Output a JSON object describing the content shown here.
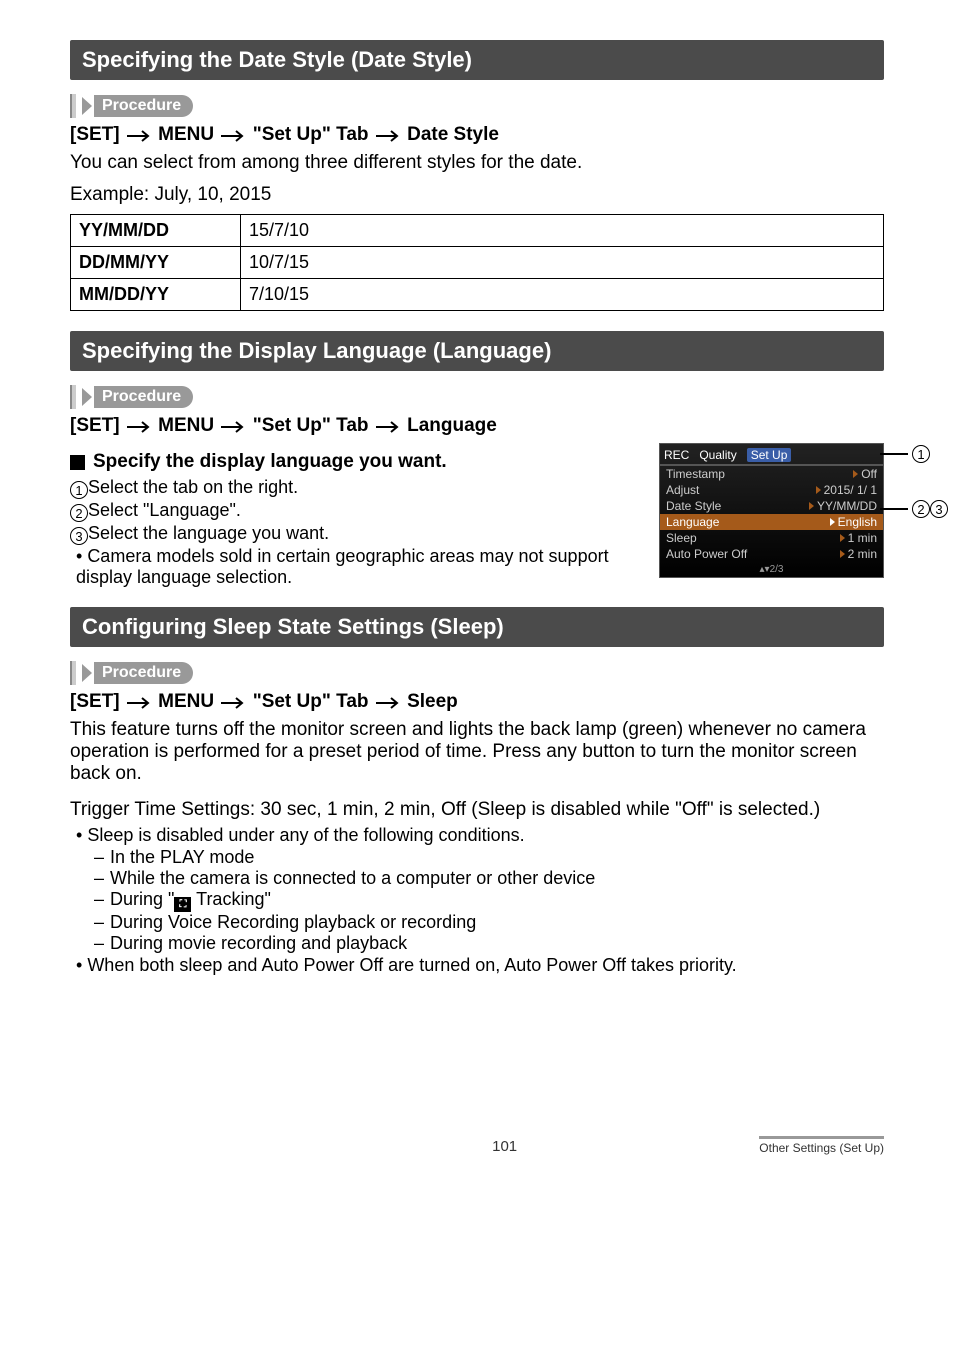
{
  "section1": {
    "title": "Specifying the Date Style (Date Style)",
    "procedure_label": "Procedure",
    "path_parts": [
      "[SET]",
      "MENU",
      "\"Set Up\" Tab",
      "Date Style"
    ],
    "intro": "You can select from among three different styles for the date.",
    "example_label": "Example: July, 10, 2015",
    "table": [
      {
        "fmt": "YY/MM/DD",
        "val": "15/7/10"
      },
      {
        "fmt": "DD/MM/YY",
        "val": "10/7/15"
      },
      {
        "fmt": "MM/DD/YY",
        "val": "7/10/15"
      }
    ]
  },
  "section2": {
    "title": "Specifying the Display Language (Language)",
    "procedure_label": "Procedure",
    "path_parts": [
      "[SET]",
      "MENU",
      "\"Set Up\" Tab",
      "Language"
    ],
    "sub_head": "Specify the display language you want.",
    "steps": [
      "Select the tab on the right.",
      "Select \"Language\".",
      "Select the language you want."
    ],
    "bullets": [
      "Camera models sold in certain geographic areas may not support display language selection."
    ],
    "camera": {
      "tabs": [
        "REC",
        "Quality",
        "Set Up"
      ],
      "rows": [
        {
          "label": "Timestamp",
          "value": "Off",
          "selected": false
        },
        {
          "label": "Adjust",
          "value": "2015/  1/  1",
          "selected": false
        },
        {
          "label": "Date Style",
          "value": "YY/MM/DD",
          "selected": false
        },
        {
          "label": "Language",
          "value": "English",
          "selected": true
        },
        {
          "label": "Sleep",
          "value": "1 min",
          "selected": false
        },
        {
          "label": "Auto Power Off",
          "value": "2 min",
          "selected": false
        }
      ],
      "footer": "2/3"
    }
  },
  "section3": {
    "title": "Configuring Sleep State Settings (Sleep)",
    "procedure_label": "Procedure",
    "path_parts": [
      "[SET]",
      "MENU",
      "\"Set Up\" Tab",
      "Sleep"
    ],
    "intro": "This feature turns off the monitor screen and lights the back lamp (green) whenever no camera operation is performed for a preset period of time. Press any button to turn the monitor screen back on.",
    "trigger": "Trigger Time Settings: 30 sec, 1 min, 2 min, Off (Sleep is disabled while \"Off\" is selected.)",
    "b1": "Sleep is disabled under any of the following conditions.",
    "dashes": [
      "In the PLAY mode",
      "While the camera is connected to a computer or other device",
      {
        "pre": "During \"",
        "post": " Tracking\""
      },
      "During Voice Recording playback or recording",
      "During movie recording and playback"
    ],
    "b2": "When both sleep and Auto Power Off are turned on, Auto Power Off takes priority."
  },
  "footer": {
    "page": "101",
    "section": "Other Settings (Set Up)"
  }
}
